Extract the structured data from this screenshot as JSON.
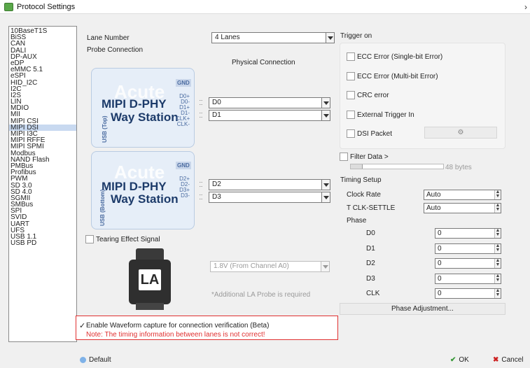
{
  "window": {
    "title": "Protocol Settings"
  },
  "protocols": [
    "10BaseT1S",
    "BiSS",
    "CAN",
    "DALI",
    "DP-AUX",
    "eDP",
    "eMMC 5.1",
    "eSPI",
    "HID_I2C",
    "I2C",
    "I2S",
    "LIN",
    "MDIO",
    "MII",
    "MIPI CSI",
    "MIPI DSI",
    "MIPI I3C",
    "MIPI RFFE",
    "MIPI SPMI",
    "Modbus",
    "NAND Flash",
    "PMBus",
    "Profibus",
    "PWM",
    "SD 3.0",
    "SD 4.0",
    "SGMII",
    "SMBus",
    "SPI",
    "SVID",
    "UART",
    "UFS",
    "USB 1.1",
    "USB PD"
  ],
  "selected_protocol": "MIPI DSI",
  "lane": {
    "label": "Lane Number",
    "value": "4 Lanes"
  },
  "probe": {
    "label": "Probe Connection",
    "physical_label": "Physical Connection",
    "watermark": "Acute",
    "top": {
      "brand1": "MIPI D-PHY",
      "brand2": "Way Station",
      "gnd": "GND",
      "pins": [
        "D0+",
        "D0-",
        "D1+",
        "D1-",
        "CLK+",
        "CLK-"
      ],
      "usb": "USB (Top)",
      "selects": [
        "D0",
        "D1"
      ]
    },
    "bottom": {
      "brand1": "MIPI D-PHY",
      "brand2": "Way Station",
      "gnd": "GND",
      "pins": [
        "D2+",
        "D2-",
        "D3+",
        "D3-"
      ],
      "usb": "USB (Bottom)",
      "selects": [
        "D2",
        "D3"
      ]
    }
  },
  "tearing": {
    "label": "Tearing Effect Signal",
    "la_text": "LA",
    "voltage": "1.8V (From Channel A0)",
    "note": "*Additional LA Probe is required"
  },
  "waveform": {
    "label": "Enable Waveform capture for connection verification (Beta)",
    "checked_mark": "✓",
    "note": "Note: The timing information between lanes is not correct!"
  },
  "trigger": {
    "label": "Trigger on",
    "options": [
      "ECC Error (Single-bit Error)",
      "ECC Error (Multi-bit Error)",
      "CRC error",
      "External Trigger In",
      "DSI Packet"
    ]
  },
  "filter": {
    "label": "Filter Data >",
    "value": "48 bytes",
    "fill": 0.13
  },
  "timing": {
    "label": "Timing Setup",
    "clock_rate": {
      "label": "Clock Rate",
      "value": "Auto"
    },
    "tclk": {
      "label": "T CLK-SETTLE",
      "value": "Auto"
    },
    "phase_label": "Phase",
    "phases": [
      {
        "name": "D0",
        "value": "0"
      },
      {
        "name": "D1",
        "value": "0"
      },
      {
        "name": "D2",
        "value": "0"
      },
      {
        "name": "D3",
        "value": "0"
      },
      {
        "name": "CLK",
        "value": "0"
      }
    ],
    "adjust_button": "Phase Adjustment..."
  },
  "footer": {
    "default": "Default",
    "ok": "OK",
    "cancel": "Cancel"
  },
  "colors": {
    "selection": "#c8d9f0",
    "note_red": "#e03030",
    "ok_green": "#3a9a3a",
    "cancel_red": "#cc2020"
  }
}
